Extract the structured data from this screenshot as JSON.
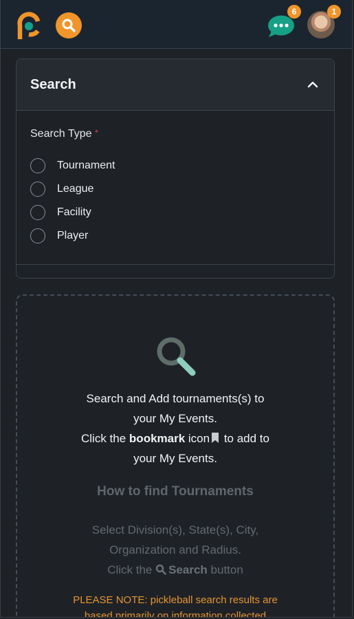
{
  "topbar": {
    "logo": "pickleball-logo",
    "search_icon": "search-icon",
    "chat_icon": "chat-bubble-icon",
    "chat_badge": "6",
    "avatar_badge": "1",
    "brand_color": "#f0952a",
    "chat_color": "#16a085"
  },
  "search_panel": {
    "title": "Search",
    "collapse_icon": "chevron-up-icon",
    "search_type_label": "Search Type",
    "required_mark": "*",
    "options": [
      {
        "label": "Tournament"
      },
      {
        "label": "League"
      },
      {
        "label": "Facility"
      },
      {
        "label": "Player"
      }
    ]
  },
  "info": {
    "icon": "magnifier-icon",
    "line1": "Search and Add tournaments(s) to",
    "line2": "your My Events.",
    "line3_prefix": "Click the ",
    "line3_bold": "bookmark",
    "line3_mid": " icon",
    "line3_suffix": " to add to",
    "line4": "your My Events.",
    "how_title": "How to find Tournaments",
    "how_line1": "Select Division(s), State(s), City,",
    "how_line2": "Organization and Radius.",
    "how_line3_prefix": "Click the ",
    "how_line3_bold": "Search",
    "how_line3_suffix": " button",
    "note_line1": "PLEASE NOTE: pickleball search results are",
    "note_line2": "based primarily on information collected"
  }
}
